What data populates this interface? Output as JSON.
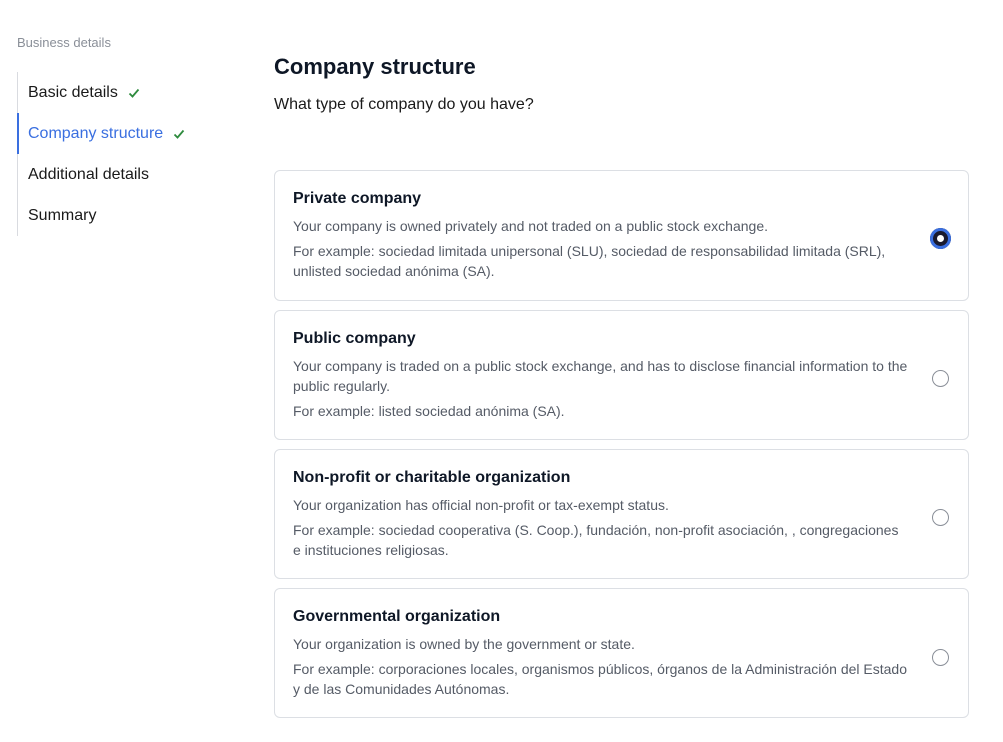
{
  "sidebar": {
    "title": "Business details",
    "steps": [
      {
        "label": "Basic details",
        "completed": true
      },
      {
        "label": "Company structure",
        "completed": true,
        "active": true
      },
      {
        "label": "Additional details",
        "completed": false
      },
      {
        "label": "Summary",
        "completed": false
      }
    ]
  },
  "main": {
    "title": "Company structure",
    "subtitle": "What type of company do you have?",
    "options": [
      {
        "title": "Private company",
        "description": "Your company is owned privately and not traded on a public stock exchange.",
        "example": "For example: sociedad limitada unipersonal (SLU), sociedad de responsabilidad limitada (SRL), unlisted sociedad anónima (SA).",
        "selected": true
      },
      {
        "title": "Public company",
        "description": "Your company is traded on a public stock exchange, and has to disclose financial information to the public regularly.",
        "example": "For example: listed sociedad anónima (SA).",
        "selected": false
      },
      {
        "title": "Non-profit or charitable organization",
        "description": "Your organization has official non-profit or tax-exempt status.",
        "example": "For example: sociedad cooperativa (S. Coop.), fundación, non-profit asociación, , congregaciones e instituciones religiosas.",
        "selected": false
      },
      {
        "title": "Governmental organization",
        "description": "Your organization is owned by the government or state.",
        "example": "For example: corporaciones locales, organismos públicos, órganos de la Administración del Estado y de las Comunidades Autónomas.",
        "selected": false
      }
    ]
  },
  "colors": {
    "accent": "#3a6fe0",
    "check": "#2e8b3e"
  }
}
